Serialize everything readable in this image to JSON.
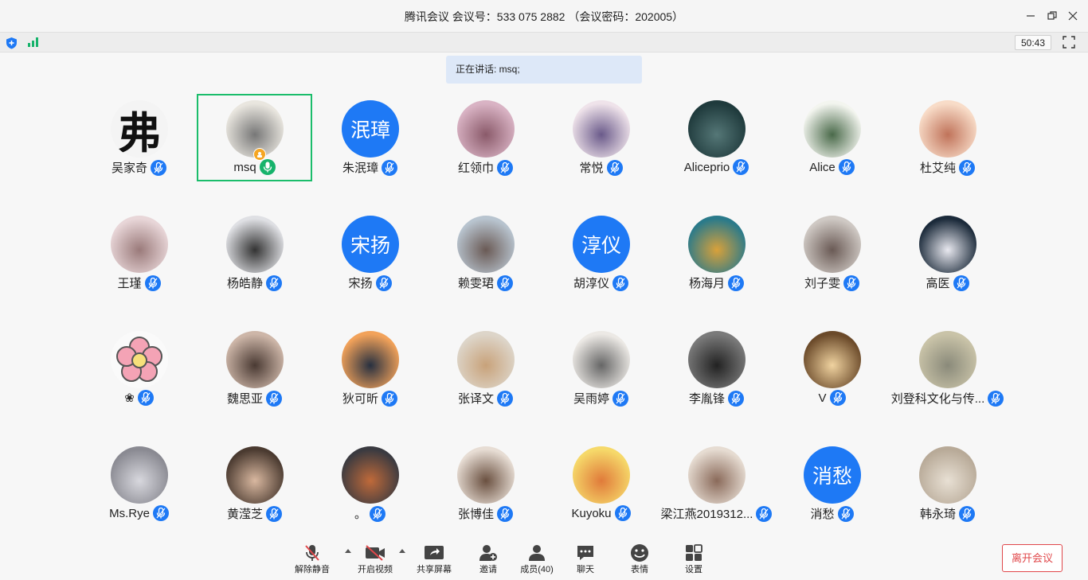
{
  "window": {
    "title": "腾讯会议 会议号：533 075 2882 （会议密码：202005）"
  },
  "status": {
    "timer": "50:43",
    "speaking_label": "正在讲话: msq;"
  },
  "participants": [
    {
      "name": "吴家奇",
      "avatar_text": "弗"
    },
    {
      "name": "msq",
      "host": true,
      "speaking": true
    },
    {
      "name": "朱泯璋",
      "avatar_text": "泯璋"
    },
    {
      "name": "红领巾"
    },
    {
      "name": "常悦"
    },
    {
      "name": "Aliceprio"
    },
    {
      "name": "Alice"
    },
    {
      "name": "杜艾纯"
    },
    {
      "name": "王瑾"
    },
    {
      "name": "杨皓静"
    },
    {
      "name": "宋扬",
      "avatar_text": "宋扬"
    },
    {
      "name": "赖雯珺"
    },
    {
      "name": "胡淳仪",
      "avatar_text": "淳仪"
    },
    {
      "name": "杨海月"
    },
    {
      "name": "刘子雯"
    },
    {
      "name": "高医"
    },
    {
      "name": "❀"
    },
    {
      "name": "魏思亚"
    },
    {
      "name": "狄可昕"
    },
    {
      "name": "张译文"
    },
    {
      "name": "吴雨婷"
    },
    {
      "name": "李胤锋"
    },
    {
      "name": "V"
    },
    {
      "name": "刘登科文化与传..."
    },
    {
      "name": "Ms.Rye"
    },
    {
      "name": "黄滢芝"
    },
    {
      "name": "。"
    },
    {
      "name": "张博佳"
    },
    {
      "name": "Kuyoku"
    },
    {
      "name": "梁江燕2019312..."
    },
    {
      "name": "消愁",
      "avatar_text": "消愁"
    },
    {
      "name": "韩永琦"
    }
  ],
  "toolbar": {
    "unmute": "解除静音",
    "start_video": "开启视频",
    "share_screen": "共享屏幕",
    "invite": "邀请",
    "members": "成员(40)",
    "chat": "聊天",
    "reactions": "表情",
    "settings": "设置",
    "leave": "离开会议"
  },
  "colors": {
    "accent_blue": "#1e79f5",
    "speaking_green": "#16b36b",
    "leave_red": "#e0474a",
    "speaking_banner": "#dde8f8"
  }
}
